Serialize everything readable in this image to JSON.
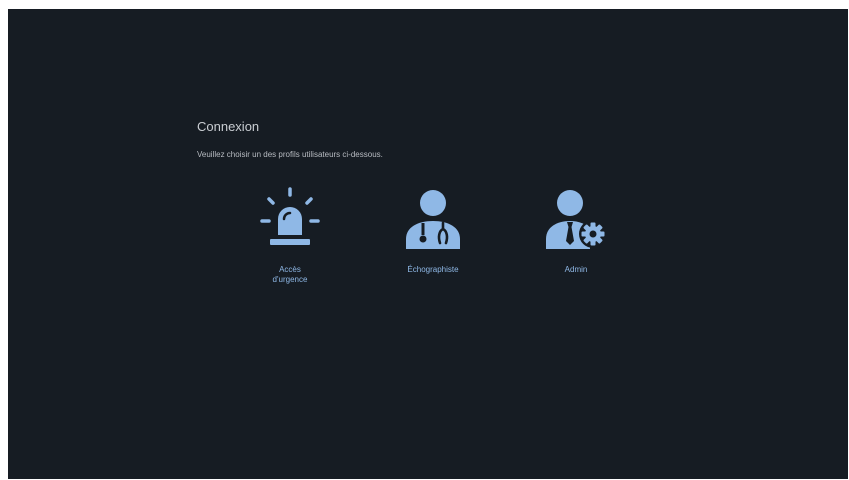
{
  "login": {
    "title": "Connexion",
    "subtitle": "Veuillez choisir un des profils utilisateurs ci-dessous."
  },
  "profiles": [
    {
      "label": "Accès\nd'urgence",
      "icon": "emergency-siren-icon"
    },
    {
      "label": "Échographiste",
      "icon": "doctor-stethoscope-icon"
    },
    {
      "label": "Admin",
      "icon": "admin-gear-icon"
    }
  ],
  "colors": {
    "background": "#161c23",
    "accent": "#8fb8e6",
    "text": "#c9cdd2"
  }
}
